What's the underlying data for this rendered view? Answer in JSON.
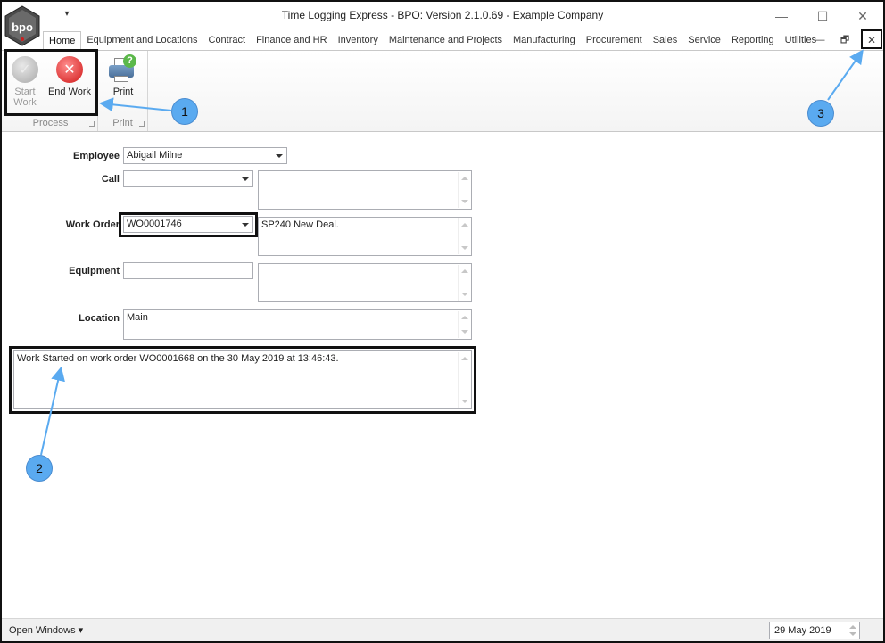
{
  "window": {
    "title": "Time Logging Express - BPO: Version 2.1.0.69 - Example Company",
    "logo_text": "bpo",
    "controls": {
      "minimize": "—",
      "maximize": "☐",
      "close": "✕"
    }
  },
  "tabs": [
    "Home",
    "Equipment and Locations",
    "Contract",
    "Finance and HR",
    "Inventory",
    "Maintenance and Projects",
    "Manufacturing",
    "Procurement",
    "Sales",
    "Service",
    "Reporting",
    "Utilities"
  ],
  "mdi": {
    "minimize": "—",
    "restore": "🗗",
    "close": "✕"
  },
  "ribbon": {
    "process_group": "Process",
    "print_group": "Print",
    "start_work_line1": "Start",
    "start_work_line2": "Work",
    "end_work": "End Work",
    "print": "Print"
  },
  "form": {
    "employee_label": "Employee",
    "employee_value": "Abigail Milne",
    "call_label": "Call",
    "call_value": "",
    "call_description": "",
    "work_order_label": "Work Order",
    "work_order_value": "WO0001746",
    "work_order_description": "SP240 New Deal.",
    "equipment_label": "Equipment",
    "equipment_value": "",
    "equipment_description": "",
    "location_label": "Location",
    "location_value": "Main",
    "log_message": "Work Started on work order WO0001668 on the 30 May 2019 at 13:46:43."
  },
  "callouts": {
    "one": "1",
    "two": "2",
    "three": "3"
  },
  "status": {
    "open_windows": "Open Windows",
    "date": "29 May 2019"
  },
  "colors": {
    "callout": "#5aaaf0",
    "highlight_border": "#111111"
  }
}
